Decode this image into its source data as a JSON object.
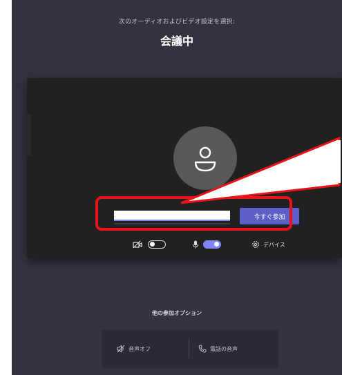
{
  "header": {
    "subtitle": "次のオーディオおよびビデオ設定を選択:",
    "title": "会議中"
  },
  "join": {
    "name_value": "",
    "button_label": "今すぐ参加"
  },
  "controls": {
    "camera_on": false,
    "mic_on": true,
    "device_label": "デバイス"
  },
  "other_options": {
    "title": "他の参加オプション",
    "audio_off_label": "音声オフ",
    "phone_audio_label": "電話の音声"
  },
  "colors": {
    "background": "#33323f",
    "preview": "#212121",
    "accent": "#5b5fc7",
    "highlight": "#e8141a"
  }
}
